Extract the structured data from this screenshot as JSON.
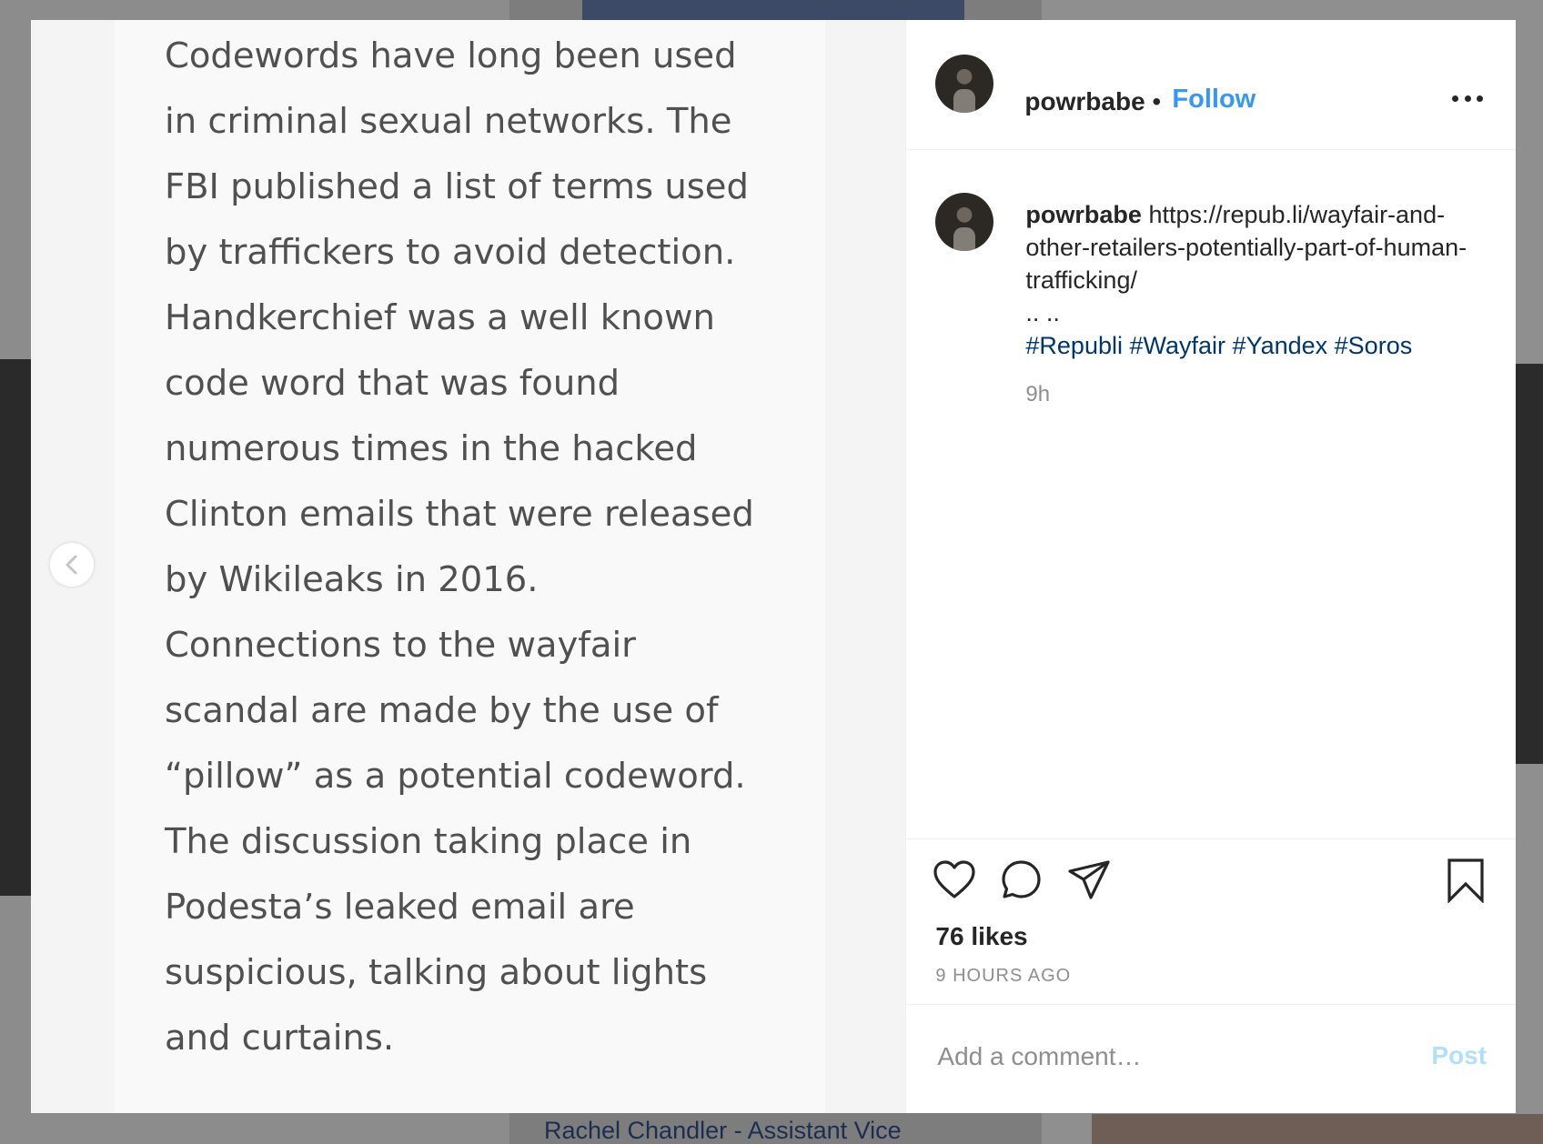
{
  "background": {
    "caption": "Rachel Chandler - Assistant Vice"
  },
  "media": {
    "text_lines": [
      "Codewords have long been used",
      "in criminal sexual networks. The",
      "FBI published a list of terms used",
      "by traffickers to avoid detection.",
      "Handkerchief was a well known",
      "code word that was found",
      "numerous times in the hacked",
      "Clinton emails that were released",
      "by Wikileaks in 2016.",
      "Connections to the wayfair",
      "scandal are made by the use of",
      "“pillow” as a potential codeword.",
      "The discussion taking place in",
      "Podesta’s leaked email are",
      "suspicious, talking about lights",
      "and curtains."
    ],
    "prev_icon": "chevron-left-icon"
  },
  "header": {
    "username": "powrbabe",
    "separator": "•",
    "follow_label": "Follow",
    "more_icon": "more-options-icon"
  },
  "caption": {
    "username": "powrbabe",
    "link": "https://repub.li/wayfair-and-other-retailers-potentially-part-of-human-trafficking/",
    "dots": ".. ..",
    "hashtags": [
      "#Republi",
      "#Wayfair",
      "#Yandex",
      "#Soros"
    ],
    "time": "9h"
  },
  "actions": {
    "icons": [
      "heart-icon",
      "comment-icon",
      "share-icon",
      "bookmark-icon"
    ],
    "likes": "76 likes",
    "posted": "9 HOURS AGO"
  },
  "comment": {
    "placeholder": "Add a comment…",
    "post_label": "Post"
  },
  "colors": {
    "link_blue": "#3897f0",
    "hashtag": "#00376b",
    "muted": "#8e8e8e",
    "post_disabled": "#b2dffc"
  }
}
